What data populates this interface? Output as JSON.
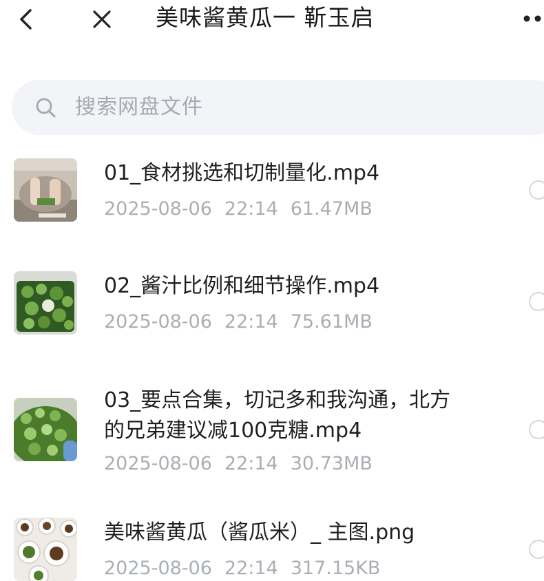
{
  "header": {
    "title": "美味酱黄瓜一 靳玉启",
    "back_icon": "chevron-left-icon",
    "close_icon": "close-icon",
    "more_icon": "more-dots-icon"
  },
  "search": {
    "placeholder": "搜索网盘文件",
    "icon": "search-icon"
  },
  "files": [
    {
      "name": "01_食材挑选和切制量化.mp4",
      "date": "2025-08-06",
      "time": "22:14",
      "size": "61.47MB"
    },
    {
      "name": "02_酱汁比例和细节操作.mp4",
      "date": "2025-08-06",
      "time": "22:14",
      "size": "75.61MB"
    },
    {
      "name_line1": "03_要点合集，切记多和我沟通，北方",
      "name_line2": "的兄弟建议减100克糖.mp4",
      "date": "2025-08-06",
      "time": "22:14",
      "size": "30.73MB"
    },
    {
      "name": "美味酱黄瓜（酱瓜米）_ 主图.png",
      "date": "2025-08-06",
      "time": "22:14",
      "size": "317.15KB"
    }
  ],
  "colors": {
    "search_bg": "#f2f4f8",
    "meta_text": "#a9aeb5",
    "placeholder": "#a6abb3"
  }
}
